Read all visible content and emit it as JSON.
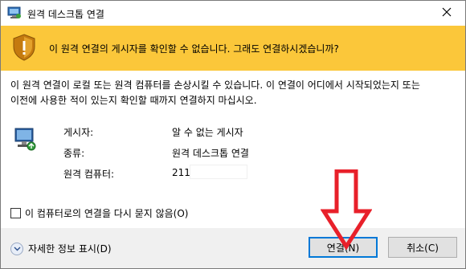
{
  "window": {
    "title": "원격 데스크톱 연결"
  },
  "banner": {
    "text": "이 원격 연결의 게시자를 확인할 수 없습니다. 그래도 연결하시겠습니까?"
  },
  "description": {
    "line1": "이 원격 연결이 로컬 또는 원격 컴퓨터를 손상시킬 수 있습니다. 이 연결이 어디에서 시작되었는지 또는",
    "line2": "이전에 사용한 적이 있는지 확인할 때까지 연결하지 마십시오."
  },
  "info": {
    "publisher_label": "게시자:",
    "publisher_value": "알 수 없는 게시자",
    "type_label": "종류:",
    "type_value": "원격 데스크톱 연결",
    "computer_label": "원격 컴퓨터:",
    "computer_value": "211."
  },
  "checkbox": {
    "label": "이 컴퓨터로의 연결을 다시 묻지 않음(O)",
    "checked": false
  },
  "details": {
    "label": "자세한 정보 표시(D)"
  },
  "buttons": {
    "connect": "연결(N)",
    "cancel": "취소(C)"
  },
  "colors": {
    "banner": "#fbc73a",
    "accent": "#0078d7",
    "arrow": "#e8202a"
  }
}
